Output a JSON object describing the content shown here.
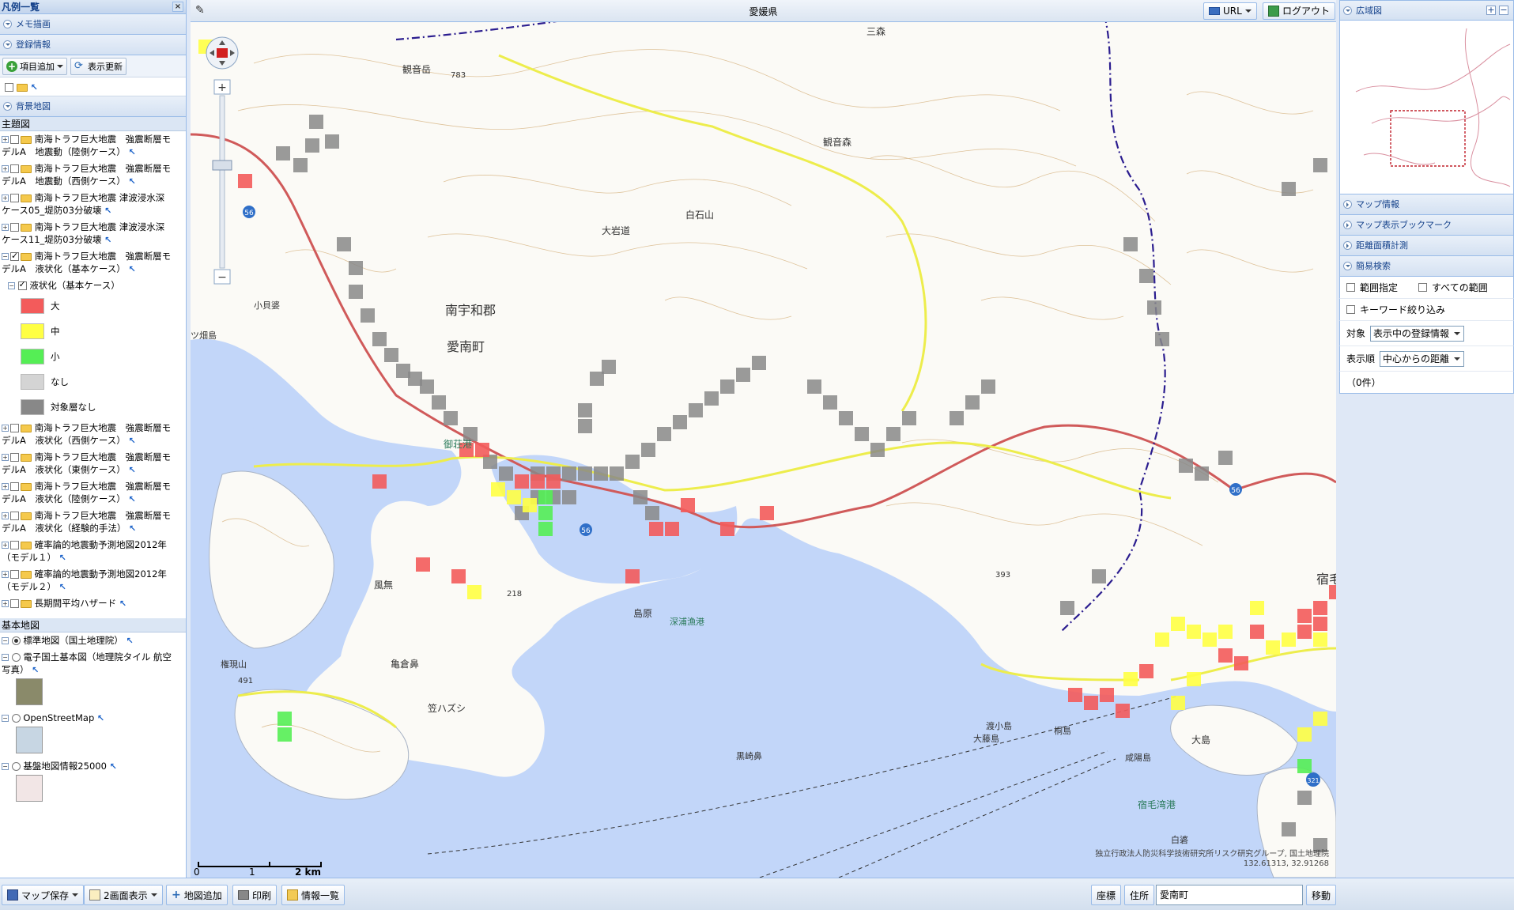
{
  "left": {
    "title": "凡例一覧",
    "memo": "メモ描画",
    "reg": "登録情報",
    "add_item": "項目追加",
    "refresh": "表示更新",
    "bg": "背景地図",
    "theme": "主題図",
    "layers_top": [
      {
        "l1": "南海トラフ巨大地震　強震断層モ",
        "l2": "デルA　地震動（陸側ケース）",
        "exp": "+",
        "checked": false
      },
      {
        "l1": "南海トラフ巨大地震　強震断層モ",
        "l2": "デルA　地震動（西側ケース）",
        "exp": "+",
        "checked": false
      },
      {
        "l1": "南海トラフ巨大地震 津波浸水深",
        "l2": "ケース05_堤防03分破壊",
        "exp": "+",
        "checked": false
      },
      {
        "l1": "南海トラフ巨大地震 津波浸水深",
        "l2": "ケース11_堤防03分破壊",
        "exp": "+",
        "checked": false
      },
      {
        "l1": "南海トラフ巨大地震　強震断層モ",
        "l2": "デルA　液状化（基本ケース）",
        "exp": "−",
        "checked": true
      }
    ],
    "sub_layer": "液状化（基本ケース）",
    "legend": [
      {
        "label": "大",
        "color": "#f35b5b"
      },
      {
        "label": "中",
        "color": "#ffff44"
      },
      {
        "label": "小",
        "color": "#55ee55"
      },
      {
        "label": "なし",
        "color": "#d4d4d4"
      },
      {
        "label": "対象層なし",
        "color": "#888888"
      }
    ],
    "layers_bottom": [
      {
        "l1": "南海トラフ巨大地震　強震断層モ",
        "l2": "デルA　液状化（西側ケース）"
      },
      {
        "l1": "南海トラフ巨大地震　強震断層モ",
        "l2": "デルA　液状化（東側ケース）"
      },
      {
        "l1": "南海トラフ巨大地震　強震断層モ",
        "l2": "デルA　液状化（陸側ケース）"
      },
      {
        "l1": "南海トラフ巨大地震　強震断層モ",
        "l2": "デルA　液状化（経験的手法）"
      },
      {
        "l1": "確率論的地震動予測地図2012年",
        "l2": "（モデル１）"
      },
      {
        "l1": "確率論的地震動予測地図2012年",
        "l2": "（モデル２）"
      },
      {
        "l1": "長期間平均ハザード",
        "l2": ""
      }
    ],
    "base": "基本地図",
    "basemaps": [
      {
        "label": "標準地図（国土地理院）",
        "l2": "",
        "selected": true
      },
      {
        "label": "電子国土基本図（地理院タイル 航空",
        "l2": "写真）",
        "selected": false
      },
      {
        "label": "OpenStreetMap",
        "l2": "",
        "selected": false
      },
      {
        "label": "基盤地図情報25000",
        "l2": "",
        "selected": false
      }
    ]
  },
  "map": {
    "title": "愛媛県",
    "url_btn": "URL",
    "logout": "ログアウト",
    "attribution": "独立行政法人防災科学技術研究所リスク研究グループ, 国土地理院",
    "coords": "132.61313, 32.91268",
    "scale_0": "0",
    "scale_1": "1",
    "scale_2": "2 km",
    "labels": {
      "district": "南宇和郡",
      "town": "愛南町",
      "kannondake": "観音岳",
      "kannonmori": "観音森",
      "sanmori": "三森",
      "shiraishi": "白石山",
      "oiwamichi": "大岩道",
      "misho_port": "御荘港",
      "fukaura": "深浦漁港",
      "shukumo": "宿毛湾港",
      "oshima": "大島",
      "kosumi": "宿毛",
      "e783": "783",
      "e393": "393",
      "e218": "218",
      "e491": "491",
      "r56a": "56",
      "r56b": "56",
      "r56c": "56",
      "r321": "321",
      "kamekura": "亀倉鼻",
      "kazehana": "風無",
      "kasahazu": "笠ハズシ",
      "shimabara": "島原",
      "kosobe": "小貝婆",
      "ohatajima": "ツ畑島",
      "tokashima": "渡小島",
      "ofujishima": "大藤島",
      "kiriishi": "桐島",
      "kanyo": "咸陽島",
      "hakuro": "白碆",
      "kurosaki": "黒崎鼻",
      "kenzan": "権現山"
    }
  },
  "right": {
    "overview": "広域図",
    "mapinfo": "マップ情報",
    "bookmark": "マップ表示ブックマーク",
    "measure": "距離面積計測",
    "search": "簡易検索",
    "range": "範囲指定",
    "all_range": "すべての範囲",
    "keyword": "キーワード絞り込み",
    "target_label": "対象",
    "target_value": "表示中の登録情報",
    "order_label": "表示順",
    "order_value": "中心からの距離",
    "count": "（0件）"
  },
  "bottom": {
    "save": "マップ保存",
    "two": "2画面表示",
    "add_map": "地図追加",
    "print": "印刷",
    "info": "情報一覧",
    "coord": "座標",
    "addr": "住所",
    "addr_value": "愛南町",
    "move": "移動"
  },
  "colors": {
    "accent": "#15428b",
    "sea": "#c2d6f9",
    "road": "#e8e85a",
    "liq_high": "#f35b5b",
    "liq_mid": "#ffff44",
    "liq_low": "#55ee55",
    "liq_none": "#888888"
  }
}
